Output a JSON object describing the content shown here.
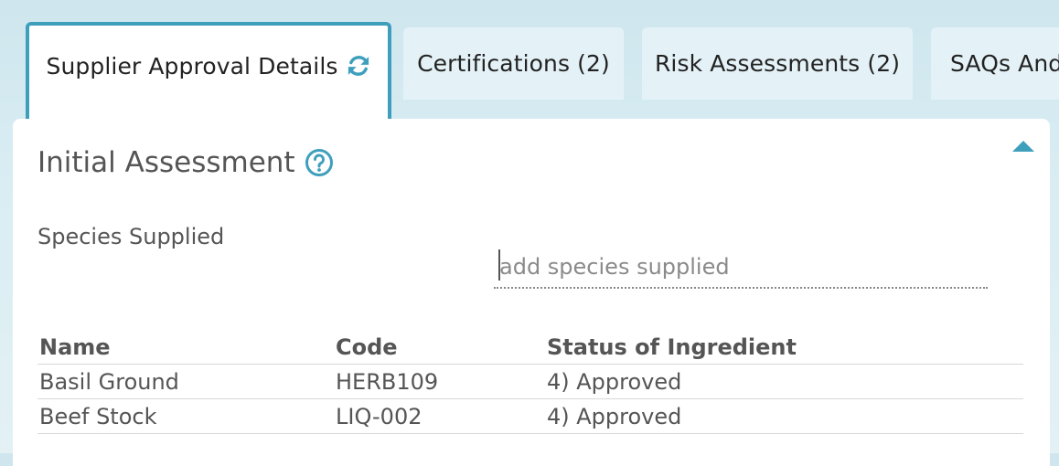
{
  "tabs": [
    {
      "label": "Supplier Approval Details",
      "active": true,
      "icon": "refresh-icon"
    },
    {
      "label": "Certifications (2)"
    },
    {
      "label": "Risk Assessments (2)"
    },
    {
      "label": "SAQs And"
    }
  ],
  "panel": {
    "title": "Initial Assessment",
    "help_icon": "question-circle-icon",
    "collapse_icon": "caret-up-icon"
  },
  "species": {
    "label": "Species Supplied",
    "placeholder": "add species supplied",
    "value": ""
  },
  "table": {
    "headers": [
      "Name",
      "Code",
      "Status of Ingredient"
    ],
    "rows": [
      [
        "Basil Ground",
        "HERB109",
        "4) Approved"
      ],
      [
        "Beef Stock",
        "LIQ-002",
        "4) Approved"
      ]
    ]
  },
  "colors": {
    "accent": "#3e9fbd",
    "tab_background": "#e4f2f7",
    "page_background": "#d6ebf2"
  }
}
